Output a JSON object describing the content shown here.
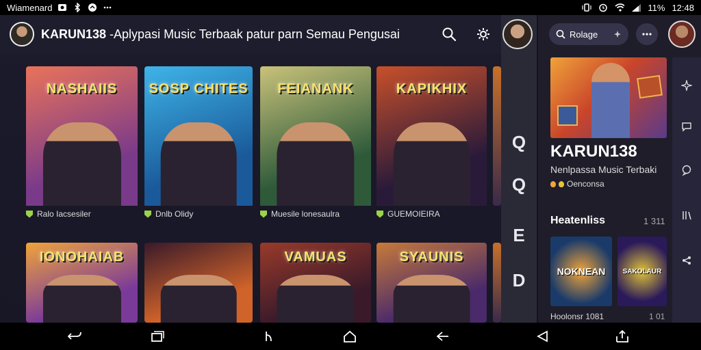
{
  "status_bar": {
    "carrier": "Wiamenard",
    "right_text": "11%",
    "time": "12:48",
    "icons": [
      "app-icon",
      "bluetooth-icon",
      "notification-icon",
      "more-icon",
      "vibrate-icon",
      "alarm-icon",
      "wifi-icon",
      "signal-icon"
    ]
  },
  "header": {
    "brand": "KARUN138",
    "tagline": " -Aplypasi Music Terbaak patur parn Semau Pengusai",
    "icons": [
      "search-icon",
      "settings-icon"
    ]
  },
  "cards": [
    {
      "title": "NASHAIIS",
      "caption": "Ralo Iacsesiler",
      "colors": [
        "#7a3a8a",
        "#e9735a"
      ]
    },
    {
      "title": "SOSP CHITES",
      "caption": "Dnlb Olidy",
      "colors": [
        "#1a5a9a",
        "#3fb4e8"
      ]
    },
    {
      "title": "FEIANANK",
      "caption": "Muesile lonesaulra",
      "colors": [
        "#2e5a3a",
        "#c9c27a"
      ]
    },
    {
      "title": "KAPIKHIX",
      "caption": "GUEMOIEIRA",
      "colors": [
        "#2a1a3a",
        "#c8502a"
      ]
    },
    {
      "title": "IONOHAIAB",
      "caption": "",
      "colors": [
        "#7a3a9a",
        "#f0a43a"
      ]
    },
    {
      "title": "",
      "caption": "",
      "colors": [
        "#d0632a",
        "#3a1a2a"
      ]
    },
    {
      "title": "VAMUAS",
      "caption": "",
      "colors": [
        "#3a1a2a",
        "#9a3a2a"
      ]
    },
    {
      "title": "SYAUNIS",
      "caption": "",
      "colors": [
        "#4a2a6a",
        "#c87a3a"
      ]
    }
  ],
  "rail": {
    "items": [
      "Q",
      "Q",
      "E",
      "D"
    ]
  },
  "panel": {
    "search_label": "Rolage",
    "title": "KARUN138",
    "subtitle": "Nenlpassa Music Terbaki",
    "meta": "Oenconsa",
    "section_title": "Heatenliss",
    "section_count": "1 311",
    "thumbs": [
      {
        "label": "NOKNEAN",
        "colors": [
          "#1a3a6a",
          "#f0a43a"
        ]
      },
      {
        "label": "SAKOLAUR",
        "colors": [
          "#2a1a5a",
          "#e0c23a"
        ]
      }
    ],
    "footer_left": "Hoolonsr 1081",
    "footer_right": "1 01"
  },
  "nav_bar": {
    "buttons": [
      "back-icon",
      "recents-icon",
      "menu-icon",
      "home-icon",
      "arrow-back-icon",
      "triangle-back-icon",
      "share-icon"
    ]
  }
}
